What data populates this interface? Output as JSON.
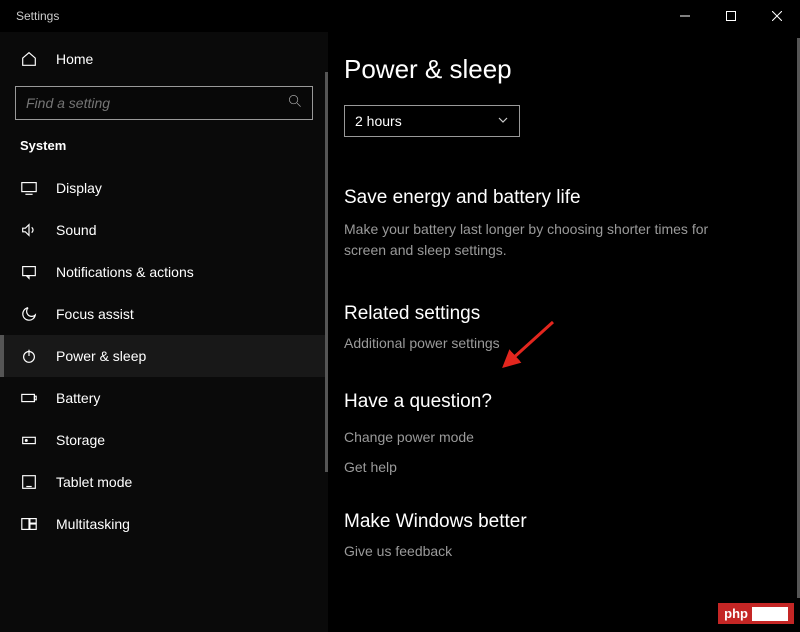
{
  "window": {
    "title": "Settings"
  },
  "sidebar": {
    "home": "Home",
    "search_placeholder": "Find a setting",
    "category": "System",
    "items": [
      {
        "label": "Display",
        "icon": "display-icon"
      },
      {
        "label": "Sound",
        "icon": "sound-icon"
      },
      {
        "label": "Notifications & actions",
        "icon": "notifications-icon"
      },
      {
        "label": "Focus assist",
        "icon": "focus-assist-icon"
      },
      {
        "label": "Power & sleep",
        "icon": "power-icon",
        "selected": true
      },
      {
        "label": "Battery",
        "icon": "battery-icon"
      },
      {
        "label": "Storage",
        "icon": "storage-icon"
      },
      {
        "label": "Tablet mode",
        "icon": "tablet-icon"
      },
      {
        "label": "Multitasking",
        "icon": "multitasking-icon"
      }
    ]
  },
  "main": {
    "title": "Power & sleep",
    "dropdown_value": "2 hours",
    "save_energy": {
      "heading": "Save energy and battery life",
      "description": "Make your battery last longer by choosing shorter times for screen and sleep settings."
    },
    "related": {
      "heading": "Related settings",
      "link": "Additional power settings"
    },
    "question": {
      "heading": "Have a question?",
      "links": [
        "Change power mode",
        "Get help"
      ]
    },
    "feedback": {
      "heading": "Make Windows better",
      "link": "Give us feedback"
    }
  },
  "watermark": "php"
}
